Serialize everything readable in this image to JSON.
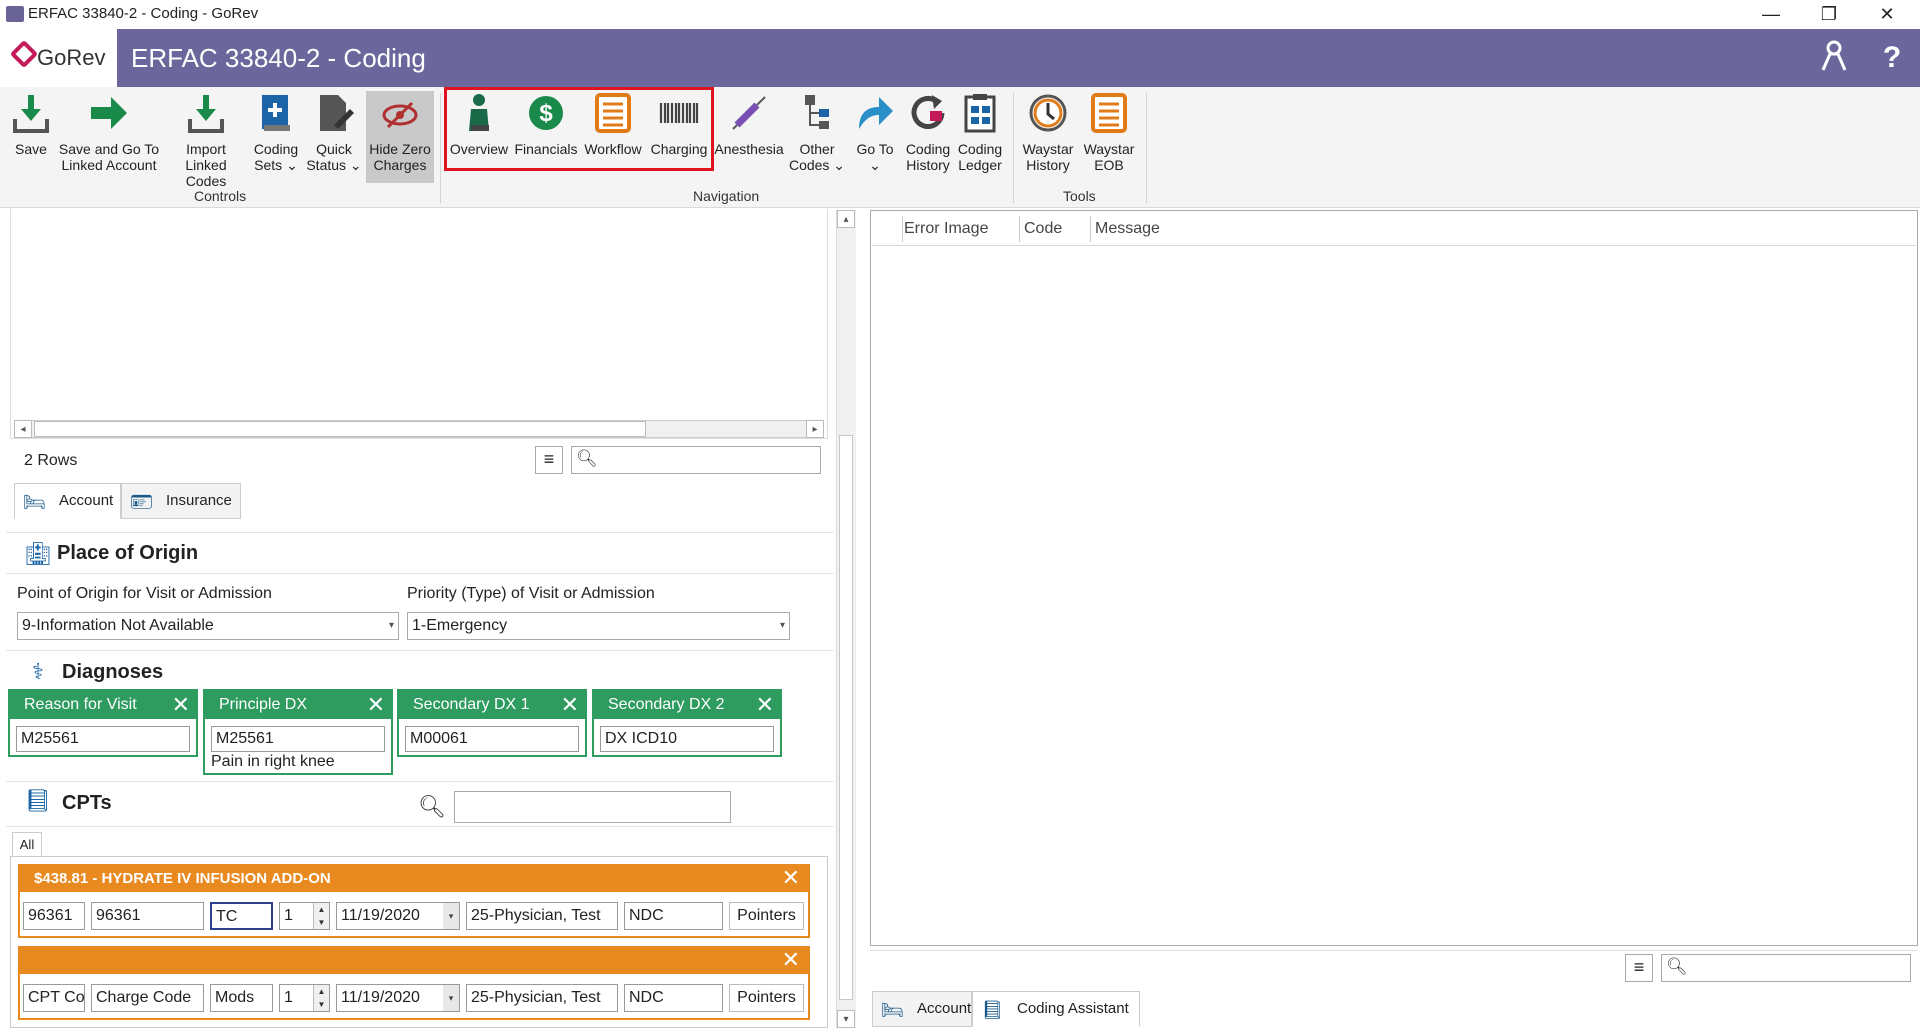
{
  "window": {
    "title": "ERFAC 33840-2 - Coding - GoRev",
    "minimize": "—",
    "restore": "❐",
    "close": "✕"
  },
  "header": {
    "logo": "GoRev",
    "title": "ERFAC 33840-2 - Coding",
    "help": "?"
  },
  "ribbon": {
    "groups": {
      "controls": "Controls",
      "navigation": "Navigation",
      "tools": "Tools"
    },
    "buttons": {
      "save": [
        "Save",
        ""
      ],
      "save_goto": [
        "Save and Go To",
        "Linked Account"
      ],
      "import": [
        "Import",
        "Linked Codes"
      ],
      "coding_sets": [
        "Coding",
        "Sets ⌄"
      ],
      "quick_status": [
        "Quick",
        "Status ⌄"
      ],
      "hide_zero": [
        "Hide Zero",
        "Charges"
      ],
      "overview": [
        "Overview",
        ""
      ],
      "financials": [
        "Financials",
        ""
      ],
      "workflow": [
        "Workflow",
        ""
      ],
      "charging": [
        "Charging",
        ""
      ],
      "anesthesia": [
        "Anesthesia",
        ""
      ],
      "other_codes": [
        "Other",
        "Codes ⌄"
      ],
      "go_to": [
        "Go To",
        "⌄"
      ],
      "coding_history": [
        "Coding",
        "History"
      ],
      "coding_ledger": [
        "Coding",
        "Ledger"
      ],
      "waystar_history": [
        "Waystar",
        "History"
      ],
      "waystar_eob": [
        "Waystar",
        "EOB"
      ]
    }
  },
  "grid": {
    "rows_label": "2 Rows"
  },
  "left_tabs": {
    "account": "Account",
    "insurance": "Insurance"
  },
  "place_of_origin": {
    "title": "Place of Origin",
    "point_label": "Point of Origin for Visit or Admission",
    "point_value": "9-Information Not Available",
    "priority_label": "Priority (Type) of Visit or Admission",
    "priority_value": "1-Emergency"
  },
  "diagnoses": {
    "title": "Diagnoses",
    "boxes": [
      {
        "label": "Reason for Visit",
        "value": "M25561",
        "desc": ""
      },
      {
        "label": "Principle DX",
        "value": "M25561",
        "desc": "Pain in right knee"
      },
      {
        "label": "Secondary DX 1",
        "value": "M00061",
        "desc": ""
      },
      {
        "label": "Secondary DX 2",
        "value": "DX ICD10",
        "desc": ""
      }
    ]
  },
  "cpts": {
    "title": "CPTs",
    "tab_all": "All",
    "rows": [
      {
        "header": "$438.81 - HYDRATE IV INFUSION ADD-ON",
        "cpt": "96361",
        "charge": "96361",
        "mods": "TC",
        "qty": "1",
        "date": "11/19/2020",
        "physician": "25-Physician, Test",
        "ndc": "NDC",
        "pointers": "Pointers"
      },
      {
        "header": "",
        "cpt": "CPT Code",
        "charge": "Charge Code",
        "mods": "Mods",
        "qty": "1",
        "date": "11/19/2020",
        "physician": "25-Physician, Test",
        "ndc": "NDC",
        "pointers": "Pointers"
      }
    ]
  },
  "errors": {
    "columns": [
      "Error Image",
      "Code",
      "Message"
    ]
  },
  "right_tabs": {
    "account": "Account",
    "coding_assistant": "Coding Assistant"
  },
  "colors": {
    "header": "#6b679c",
    "diag_green": "#2e9b5f",
    "cpt_orange": "#e98a21",
    "highlight_red": "#e0141e"
  }
}
